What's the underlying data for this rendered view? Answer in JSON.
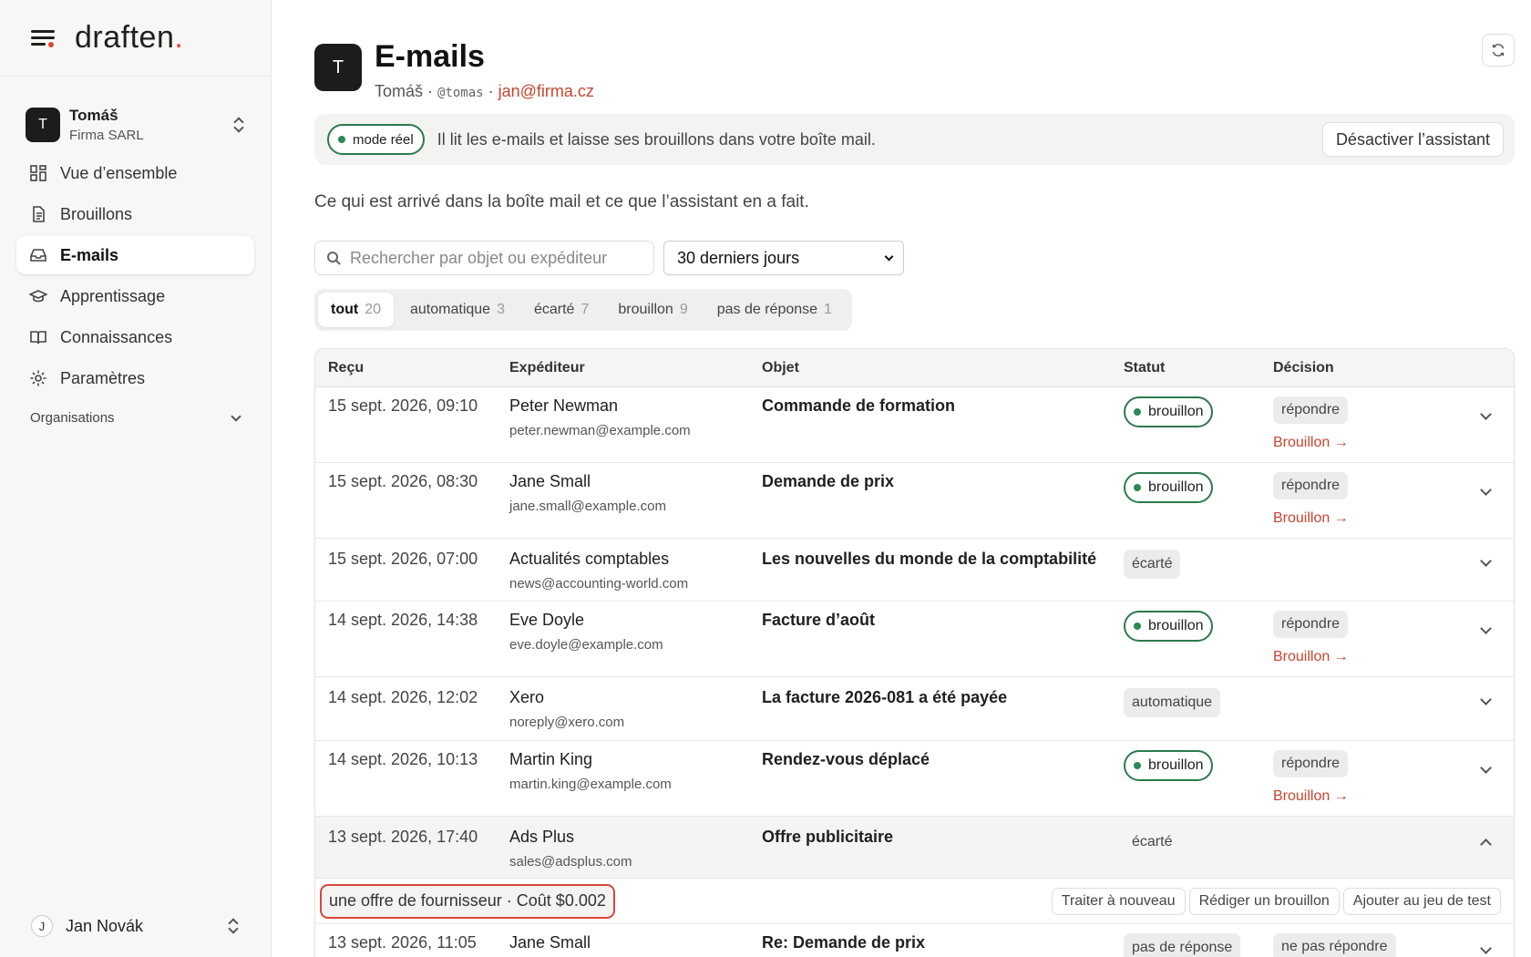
{
  "app": {
    "logo": "draften",
    "logo_dot": "."
  },
  "sidebar": {
    "org": {
      "initial": "T",
      "name": "Tomáš",
      "company": "Firma SARL"
    },
    "items": [
      {
        "label": "Vue d’ensemble",
        "icon": "grid-icon"
      },
      {
        "label": "Brouillons",
        "icon": "document-icon"
      },
      {
        "label": "E-mails",
        "icon": "inbox-icon",
        "active": true
      },
      {
        "label": "Apprentissage",
        "icon": "graduation-cap-icon"
      },
      {
        "label": "Connaissances",
        "icon": "book-icon"
      },
      {
        "label": "Paramètres",
        "icon": "gear-icon"
      }
    ],
    "organisations_label": "Organisations",
    "user": {
      "initial": "J",
      "name": "Jan Novák"
    }
  },
  "header": {
    "initial": "T",
    "title": "E-mails",
    "name": "Tomáš",
    "sep1": " · ",
    "handle": "@tomas",
    "sep2": " · ",
    "email": "jan@firma.cz"
  },
  "banner": {
    "mode": "mode réel",
    "text": "Il lit les e-mails et laisse ses brouillons dans votre boîte mail.",
    "button": "Désactiver l’assistant"
  },
  "subtitle": "Ce qui est arrivé dans la boîte mail et ce que l’assistant en a fait.",
  "filters": {
    "search_placeholder": "Rechercher par objet ou expéditeur",
    "period": "30 derniers jours"
  },
  "tabs": [
    {
      "label": "tout",
      "count": "20",
      "active": true
    },
    {
      "label": "automatique",
      "count": "3"
    },
    {
      "label": "écarté",
      "count": "7"
    },
    {
      "label": "brouillon",
      "count": "9"
    },
    {
      "label": "pas de réponse",
      "count": "1"
    }
  ],
  "table": {
    "columns": [
      "Reçu",
      "Expéditeur",
      "Objet",
      "Statut",
      "Décision"
    ],
    "draft_link": "Brouillon →",
    "rows": [
      {
        "date": "15 sept. 2026, 09:10",
        "name": "Peter Newman",
        "email": "peter.newman@example.com",
        "subject": "Commande de formation",
        "status": "brouillon",
        "decision": "répondre"
      },
      {
        "date": "15 sept. 2026, 08:30",
        "name": "Jane Small",
        "email": "jane.small@example.com",
        "subject": "Demande de prix",
        "status": "brouillon",
        "decision": "répondre"
      },
      {
        "date": "15 sept. 2026, 07:00",
        "name": "Actualités comptables",
        "email": "news@accounting-world.com",
        "subject": "Les nouvelles du monde de la comptabilité",
        "status": "écarté",
        "decision": ""
      },
      {
        "date": "14 sept. 2026, 14:38",
        "name": "Eve Doyle",
        "email": "eve.doyle@example.com",
        "subject": "Facture d’août",
        "status": "brouillon",
        "decision": "répondre"
      },
      {
        "date": "14 sept. 2026, 12:02",
        "name": "Xero",
        "email": "noreply@xero.com",
        "subject": "La facture 2026-081 a été payée",
        "status": "automatique",
        "decision": ""
      },
      {
        "date": "14 sept. 2026, 10:13",
        "name": "Martin King",
        "email": "martin.king@example.com",
        "subject": "Rendez-vous déplacé",
        "status": "brouillon",
        "decision": "répondre"
      },
      {
        "date": "13 sept. 2026, 17:40",
        "name": "Ads Plus",
        "email": "sales@adsplus.com",
        "subject": "Offre publicitaire",
        "status": "écarté",
        "decision": "",
        "expanded": true
      },
      {
        "date": "13 sept. 2026, 11:05",
        "name": "Jane Small",
        "email": "",
        "subject": "Re: Demande de prix",
        "status": "pas de réponse",
        "decision": "ne pas répondre"
      }
    ],
    "detail": {
      "summary": "une offre de fournisseur · Coût $0.002",
      "actions": [
        "Traiter à nouveau",
        "Rédiger un brouillon",
        "Ajouter au jeu de test"
      ]
    }
  },
  "colors": {
    "accent": "#c8452f",
    "brand_dot": "#e2452b",
    "status_green": "#2d7a4b",
    "highlight_red": "#d9473b"
  }
}
